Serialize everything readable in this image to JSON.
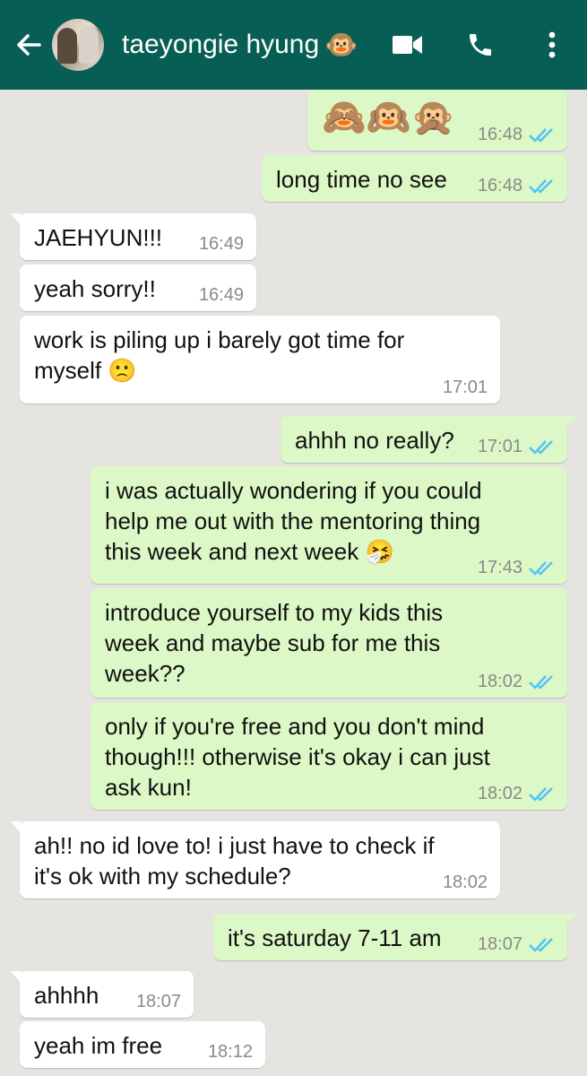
{
  "header": {
    "contact_name": "taeyongie hyung",
    "contact_emoji": "🐵",
    "back_icon": "arrow-left-icon",
    "video_icon": "video-camera-icon",
    "call_icon": "phone-icon",
    "menu_icon": "more-vertical-icon",
    "bg_color": "#075e54"
  },
  "colors": {
    "outgoing_bubble": "#dcf8c6",
    "incoming_bubble": "#ffffff",
    "read_tick": "#4fc3f7",
    "background": "#e5e4e1"
  },
  "messages": [
    {
      "dir": "out",
      "text": "🙈🙉🙊",
      "time": "16:48",
      "read": true
    },
    {
      "dir": "out",
      "text": "long time no see",
      "time": "16:48",
      "read": true
    },
    {
      "dir": "in",
      "text": "JAEHYUN!!!",
      "time": "16:49"
    },
    {
      "dir": "in",
      "text": "yeah sorry!!",
      "time": "16:49"
    },
    {
      "dir": "in",
      "text": "work is piling up i barely got time for\nmyself 🙁",
      "time": "17:01"
    },
    {
      "dir": "out",
      "text": "ahhh no really?",
      "time": "17:01",
      "read": true
    },
    {
      "dir": "out",
      "text": "i was actually wondering if you could\nhelp me out with the mentoring thing\nthis week and next week 🤧",
      "time": "17:43",
      "read": true
    },
    {
      "dir": "out",
      "text": "introduce yourself to my kids this\nweek and maybe sub for me this\nweek??",
      "time": "18:02",
      "read": true
    },
    {
      "dir": "out",
      "text": "only if you're free and you don't mind\nthough!!! otherwise it's okay i can just\nask kun!",
      "time": "18:02",
      "read": true
    },
    {
      "dir": "in",
      "text": "ah!! no id love to! i just have to check if\nit's ok with my schedule?",
      "time": "18:02"
    },
    {
      "dir": "out",
      "text": "it's saturday 7-11 am",
      "time": "18:07",
      "read": true
    },
    {
      "dir": "in",
      "text": "ahhhh",
      "time": "18:07"
    },
    {
      "dir": "in",
      "text": "yeah im free",
      "time": "18:12"
    }
  ]
}
